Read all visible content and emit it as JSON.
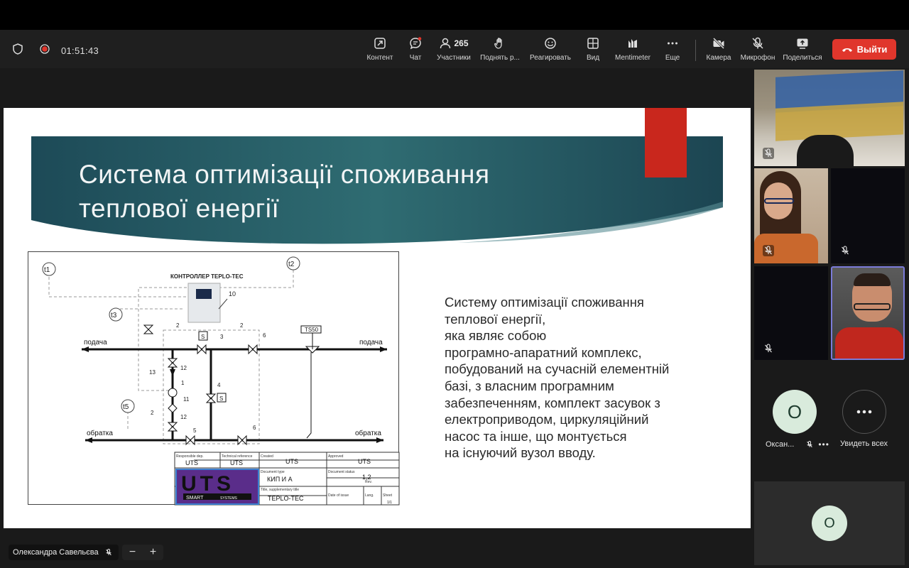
{
  "meeting": {
    "timer": "01:51:43",
    "participants_count": "265"
  },
  "toolbar": {
    "items": [
      {
        "label": "Контент",
        "icon": "share-content-icon"
      },
      {
        "label": "Чат",
        "icon": "chat-icon"
      },
      {
        "label": "Участники",
        "icon": "participants-icon"
      },
      {
        "label": "Поднять р...",
        "icon": "raise-hand-icon"
      },
      {
        "label": "Реагировать",
        "icon": "react-icon"
      },
      {
        "label": "Вид",
        "icon": "view-icon"
      },
      {
        "label": "Mentimeter",
        "icon": "mentimeter-icon"
      },
      {
        "label": "Еще",
        "icon": "more-icon"
      },
      {
        "label": "Камера",
        "icon": "camera-off-icon"
      },
      {
        "label": "Микрофон",
        "icon": "mic-off-icon"
      },
      {
        "label": "Поделиться",
        "icon": "share-screen-icon"
      }
    ],
    "leave_label": "Выйти"
  },
  "slide": {
    "title": "Система оптимізації споживання\nтеплової енергії",
    "body": "Систему оптимізації споживання\nтеплової енергії,\nяка являє собою\nпрограмно-апаратний комплекс,\nпобудований на сучасній елементній\nбазі, з власним програмним\nзабезпеченням, комплект засувок з\nелектроприводом, циркуляційний\nнасос та інше, що монтується\nна існуючий вузол вводу."
  },
  "diagram": {
    "controller_label": "КОНТРОЛЛЕР TEPLO-TEC",
    "supply_label": "подача",
    "return_label": "обратка",
    "sensors": [
      "t1",
      "t2",
      "t3",
      "t5"
    ],
    "ts_label": "TS50",
    "numbers": [
      "10",
      "2",
      "3",
      "2",
      "6",
      "S",
      "12",
      "13",
      "1",
      "11",
      "12",
      "2",
      "4",
      "S",
      "5",
      "6"
    ],
    "stamp": {
      "responsible_dep_label": "Responsible dep.",
      "responsible_dep": "UTS",
      "technical_ref_label": "Technical reference",
      "technical_ref": "UTS",
      "created_label": "Created",
      "created": "UTS",
      "approved_label": "Approved",
      "approved": "UTS",
      "doc_type_label": "Document type",
      "doc_type": "КИП И А",
      "doc_status_label": "Document status",
      "doc_status": "1,2",
      "title_label": "Title, supplementary title",
      "title_value": "TEPLO-TEC",
      "rev_label": "Rev.",
      "date_label": "Date of issue",
      "lang_label": "Lang.",
      "sheet_label": "Sheet",
      "sheet": "1/1",
      "logo_main": "UTS",
      "logo_sub1": "SMART",
      "logo_sub2": "SYSTEMS"
    }
  },
  "participants": {
    "tile_oksana_initial": "О",
    "tile_oksana_name": "Оксан...",
    "see_all_label": "Увидеть всех",
    "bottom_tile_initial": "О"
  },
  "presenter": {
    "name": "Олександра Савельєва"
  },
  "colors": {
    "leave": "#e0362c",
    "active_speaker_border": "#7b7bd9",
    "avatar_bg": "#d9ebdc",
    "red_tab": "#c9271d"
  }
}
